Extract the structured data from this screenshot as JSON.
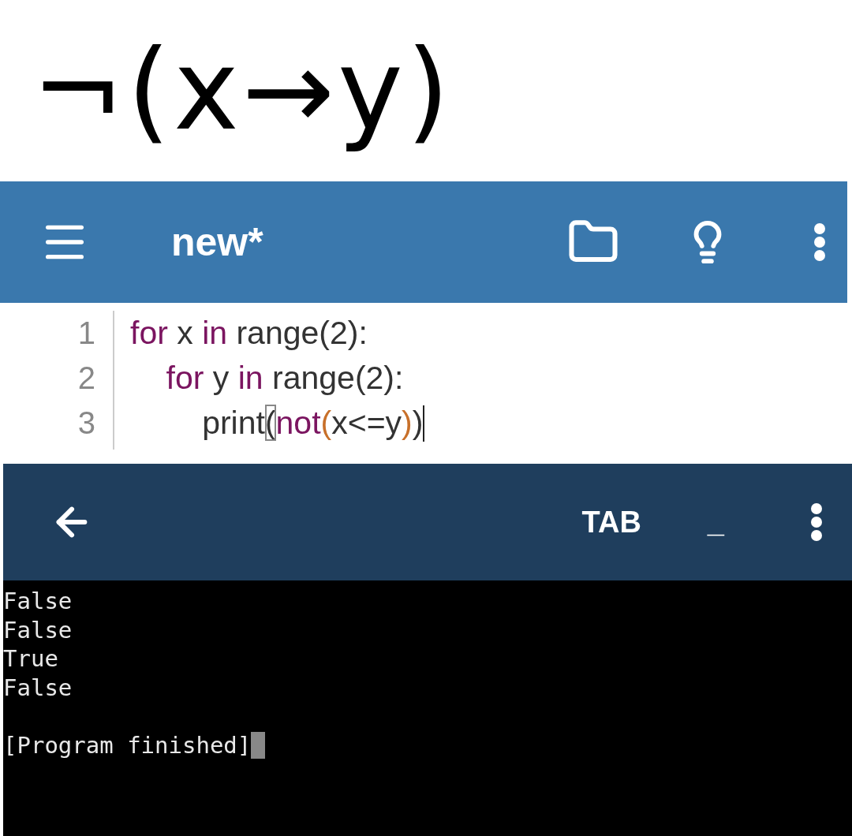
{
  "formula": {
    "text": "¬(x→y)"
  },
  "app_bar": {
    "title": "new*"
  },
  "editor": {
    "lines": [
      {
        "number": "1",
        "tokens": [
          {
            "kind": "keyword",
            "text": "for"
          },
          {
            "kind": "plain",
            "text": " x "
          },
          {
            "kind": "keyword",
            "text": "in"
          },
          {
            "kind": "plain",
            "text": " range(2):"
          }
        ],
        "caret": false
      },
      {
        "number": "2",
        "tokens": [
          {
            "kind": "keyword",
            "text": "    for"
          },
          {
            "kind": "plain",
            "text": " y "
          },
          {
            "kind": "keyword",
            "text": "in"
          },
          {
            "kind": "plain",
            "text": " range(2):"
          }
        ],
        "caret": false
      },
      {
        "number": "3",
        "tokens": [
          {
            "kind": "plain",
            "text": "        print"
          },
          {
            "kind": "matched",
            "text": "("
          },
          {
            "kind": "keyword",
            "text": "not"
          },
          {
            "kind": "paren",
            "text": "("
          },
          {
            "kind": "plain",
            "text": "x<=y"
          },
          {
            "kind": "paren",
            "text": ")"
          },
          {
            "kind": "plain",
            "text": ")"
          }
        ],
        "caret": true
      }
    ]
  },
  "terminal_bar": {
    "tab_key": "TAB",
    "underscore_key": "_"
  },
  "terminal": {
    "lines": [
      "False",
      "False",
      "True",
      "False"
    ],
    "status": "[Program finished]"
  }
}
